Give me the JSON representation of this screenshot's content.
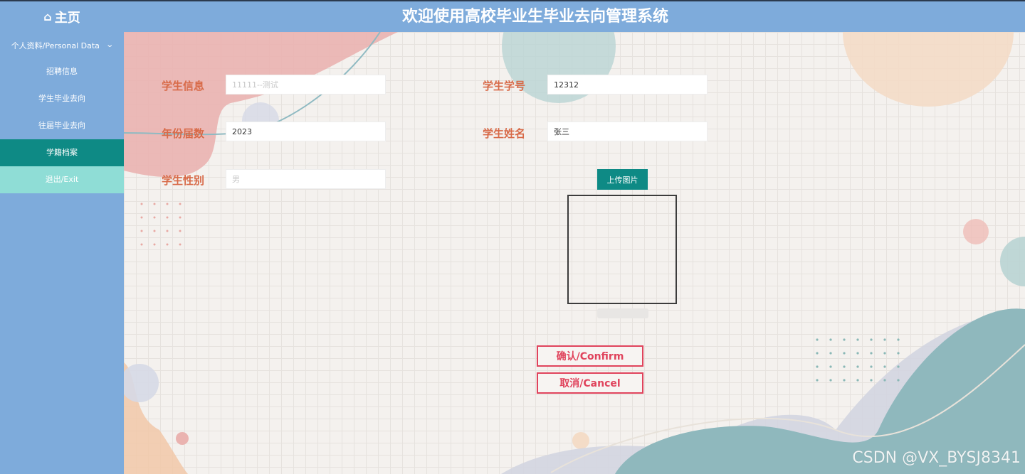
{
  "header": {
    "home_icon": "home-icon",
    "home_label": "主页",
    "title": "欢迎使用高校毕业生毕业去向管理系统"
  },
  "sidebar": {
    "group_label": "个人资料/Personal Data",
    "items": [
      {
        "label": "招聘信息"
      },
      {
        "label": "学生毕业去向"
      },
      {
        "label": "往届毕业去向"
      },
      {
        "label": "学籍档案"
      },
      {
        "label": "退出/Exit"
      }
    ]
  },
  "form": {
    "student_info_label": "学生信息",
    "student_info_value": "11111--测试",
    "student_no_label": "学生学号",
    "student_no_value": "12312",
    "year_label": "年份届数",
    "year_value": "2023",
    "student_name_label": "学生姓名",
    "student_name_value": "张三",
    "gender_label": "学生性别",
    "gender_value": "男",
    "upload_label": "上传图片"
  },
  "actions": {
    "confirm_label": "确认/Confirm",
    "cancel_label": "取消/Cancel"
  },
  "watermark": "CSDN @VX_BYSJ8341",
  "colors": {
    "sidebar_bg": "#7eabdb",
    "active_item": "#0e8a85",
    "exit_item": "#8fddd6",
    "label_text": "#d86a48",
    "action_border": "#e0435c"
  }
}
